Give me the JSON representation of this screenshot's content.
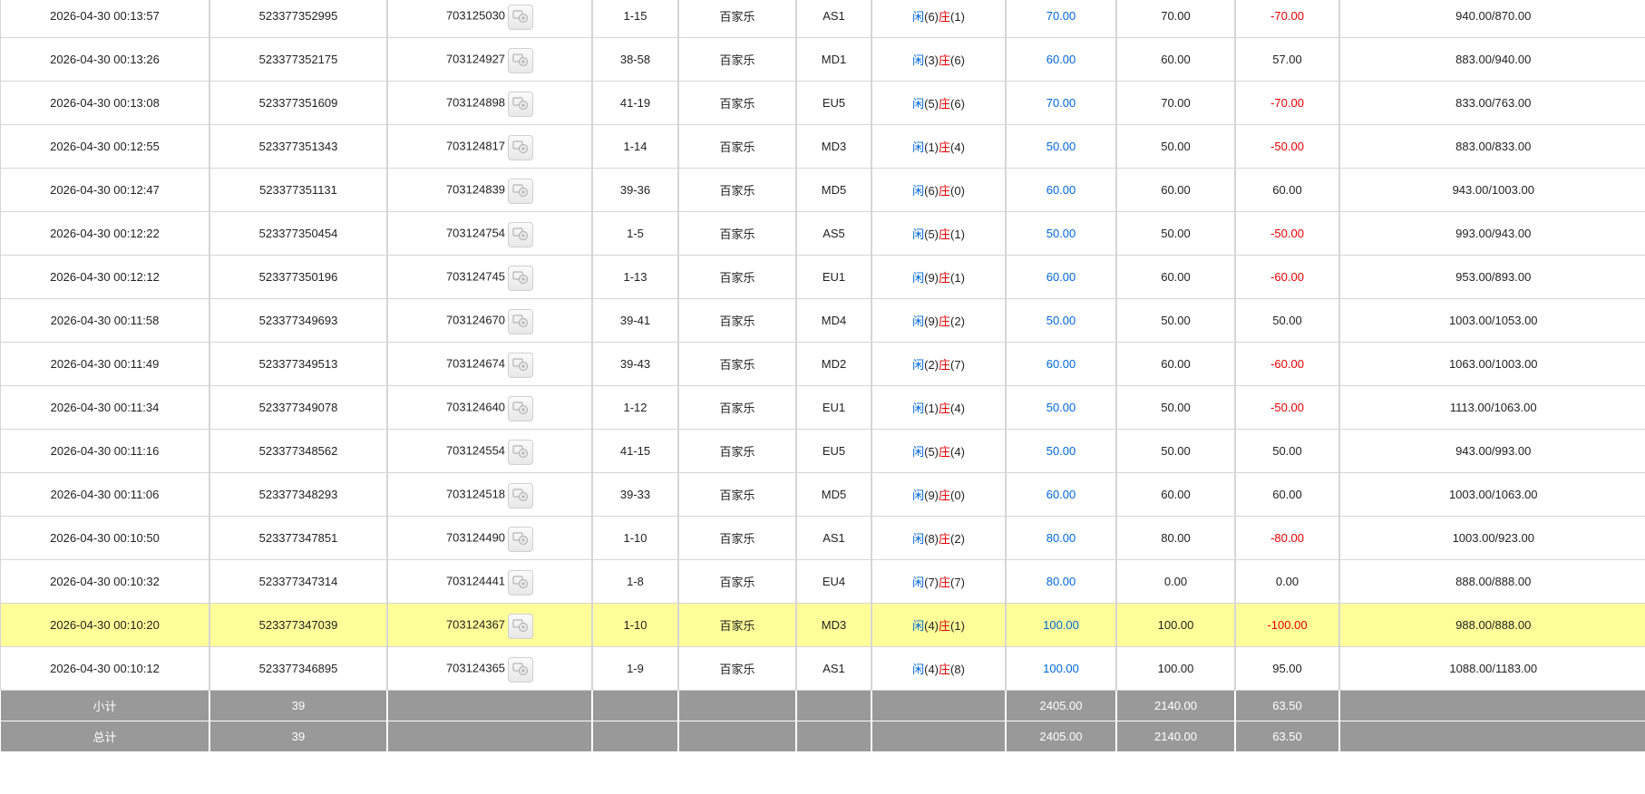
{
  "rows": [
    {
      "time": "2026-04-30 00:13:57",
      "order": "523377352995",
      "round": "703125030",
      "table": "1-15",
      "game": "百家乐",
      "room": "AS1",
      "idle_label": "闲",
      "idle": "(6)",
      "banker_label": "庄",
      "banker": "(1)",
      "bet": "70.00",
      "valid": "70.00",
      "result": "-70.00",
      "result_red": true,
      "balance": "940.00/870.00"
    },
    {
      "time": "2026-04-30 00:13:26",
      "order": "523377352175",
      "round": "703124927",
      "table": "38-58",
      "game": "百家乐",
      "room": "MD1",
      "idle_label": "闲",
      "idle": "(3)",
      "banker_label": "庄",
      "banker": "(6)",
      "bet": "60.00",
      "valid": "60.00",
      "result": "57.00",
      "result_red": false,
      "balance": "883.00/940.00"
    },
    {
      "time": "2026-04-30 00:13:08",
      "order": "523377351609",
      "round": "703124898",
      "table": "41-19",
      "game": "百家乐",
      "room": "EU5",
      "idle_label": "闲",
      "idle": "(5)",
      "banker_label": "庄",
      "banker": "(6)",
      "bet": "70.00",
      "valid": "70.00",
      "result": "-70.00",
      "result_red": true,
      "balance": "833.00/763.00"
    },
    {
      "time": "2026-04-30 00:12:55",
      "order": "523377351343",
      "round": "703124817",
      "table": "1-14",
      "game": "百家乐",
      "room": "MD3",
      "idle_label": "闲",
      "idle": "(1)",
      "banker_label": "庄",
      "banker": "(4)",
      "bet": "50.00",
      "valid": "50.00",
      "result": "-50.00",
      "result_red": true,
      "balance": "883.00/833.00"
    },
    {
      "time": "2026-04-30 00:12:47",
      "order": "523377351131",
      "round": "703124839",
      "table": "39-36",
      "game": "百家乐",
      "room": "MD5",
      "idle_label": "闲",
      "idle": "(6)",
      "banker_label": "庄",
      "banker": "(0)",
      "bet": "60.00",
      "valid": "60.00",
      "result": "60.00",
      "result_red": false,
      "balance": "943.00/1003.00"
    },
    {
      "time": "2026-04-30 00:12:22",
      "order": "523377350454",
      "round": "703124754",
      "table": "1-5",
      "game": "百家乐",
      "room": "AS5",
      "idle_label": "闲",
      "idle": "(5)",
      "banker_label": "庄",
      "banker": "(1)",
      "bet": "50.00",
      "valid": "50.00",
      "result": "-50.00",
      "result_red": true,
      "balance": "993.00/943.00"
    },
    {
      "time": "2026-04-30 00:12:12",
      "order": "523377350196",
      "round": "703124745",
      "table": "1-13",
      "game": "百家乐",
      "room": "EU1",
      "idle_label": "闲",
      "idle": "(9)",
      "banker_label": "庄",
      "banker": "(1)",
      "bet": "60.00",
      "valid": "60.00",
      "result": "-60.00",
      "result_red": true,
      "balance": "953.00/893.00"
    },
    {
      "time": "2026-04-30 00:11:58",
      "order": "523377349693",
      "round": "703124670",
      "table": "39-41",
      "game": "百家乐",
      "room": "MD4",
      "idle_label": "闲",
      "idle": "(9)",
      "banker_label": "庄",
      "banker": "(2)",
      "bet": "50.00",
      "valid": "50.00",
      "result": "50.00",
      "result_red": false,
      "balance": "1003.00/1053.00"
    },
    {
      "time": "2026-04-30 00:11:49",
      "order": "523377349513",
      "round": "703124674",
      "table": "39-43",
      "game": "百家乐",
      "room": "MD2",
      "idle_label": "闲",
      "idle": "(2)",
      "banker_label": "庄",
      "banker": "(7)",
      "bet": "60.00",
      "valid": "60.00",
      "result": "-60.00",
      "result_red": true,
      "balance": "1063.00/1003.00"
    },
    {
      "time": "2026-04-30 00:11:34",
      "order": "523377349078",
      "round": "703124640",
      "table": "1-12",
      "game": "百家乐",
      "room": "EU1",
      "idle_label": "闲",
      "idle": "(1)",
      "banker_label": "庄",
      "banker": "(4)",
      "bet": "50.00",
      "valid": "50.00",
      "result": "-50.00",
      "result_red": true,
      "balance": "1113.00/1063.00"
    },
    {
      "time": "2026-04-30 00:11:16",
      "order": "523377348562",
      "round": "703124554",
      "table": "41-15",
      "game": "百家乐",
      "room": "EU5",
      "idle_label": "闲",
      "idle": "(5)",
      "banker_label": "庄",
      "banker": "(4)",
      "bet": "50.00",
      "valid": "50.00",
      "result": "50.00",
      "result_red": false,
      "balance": "943.00/993.00"
    },
    {
      "time": "2026-04-30 00:11:06",
      "order": "523377348293",
      "round": "703124518",
      "table": "39-33",
      "game": "百家乐",
      "room": "MD5",
      "idle_label": "闲",
      "idle": "(9)",
      "banker_label": "庄",
      "banker": "(0)",
      "bet": "60.00",
      "valid": "60.00",
      "result": "60.00",
      "result_red": false,
      "balance": "1003.00/1063.00"
    },
    {
      "time": "2026-04-30 00:10:50",
      "order": "523377347851",
      "round": "703124490",
      "table": "1-10",
      "game": "百家乐",
      "room": "AS1",
      "idle_label": "闲",
      "idle": "(8)",
      "banker_label": "庄",
      "banker": "(2)",
      "bet": "80.00",
      "valid": "80.00",
      "result": "-80.00",
      "result_red": true,
      "balance": "1003.00/923.00"
    },
    {
      "time": "2026-04-30 00:10:32",
      "order": "523377347314",
      "round": "703124441",
      "table": "1-8",
      "game": "百家乐",
      "room": "EU4",
      "idle_label": "闲",
      "idle": "(7)",
      "banker_label": "庄",
      "banker": "(7)",
      "bet": "80.00",
      "valid": "0.00",
      "result": "0.00",
      "result_red": false,
      "balance": "888.00/888.00"
    },
    {
      "time": "2026-04-30 00:10:20",
      "order": "523377347039",
      "round": "703124367",
      "table": "1-10",
      "game": "百家乐",
      "room": "MD3",
      "idle_label": "闲",
      "idle": "(4)",
      "banker_label": "庄",
      "banker": "(1)",
      "bet": "100.00",
      "valid": "100.00",
      "result": "-100.00",
      "result_red": true,
      "balance": "988.00/888.00",
      "highlight": true
    },
    {
      "time": "2026-04-30 00:10:12",
      "order": "523377346895",
      "round": "703124365",
      "table": "1-9",
      "game": "百家乐",
      "room": "AS1",
      "idle_label": "闲",
      "idle": "(4)",
      "banker_label": "庄",
      "banker": "(8)",
      "bet": "100.00",
      "valid": "100.00",
      "result": "95.00",
      "result_red": false,
      "balance": "1088.00/1183.00"
    }
  ],
  "subtotal": {
    "label": "小计",
    "count": "39",
    "bet": "2405.00",
    "valid": "2140.00",
    "result": "63.50"
  },
  "total": {
    "label": "总计",
    "count": "39",
    "bet": "2405.00",
    "valid": "2140.00",
    "result": "63.50"
  },
  "colors": {
    "blue": "#0066dd",
    "red": "#e60000",
    "highlight": "#ffff99",
    "summary_bg": "#999999"
  },
  "icons": {
    "round_detail": "poker-chip-icon"
  }
}
